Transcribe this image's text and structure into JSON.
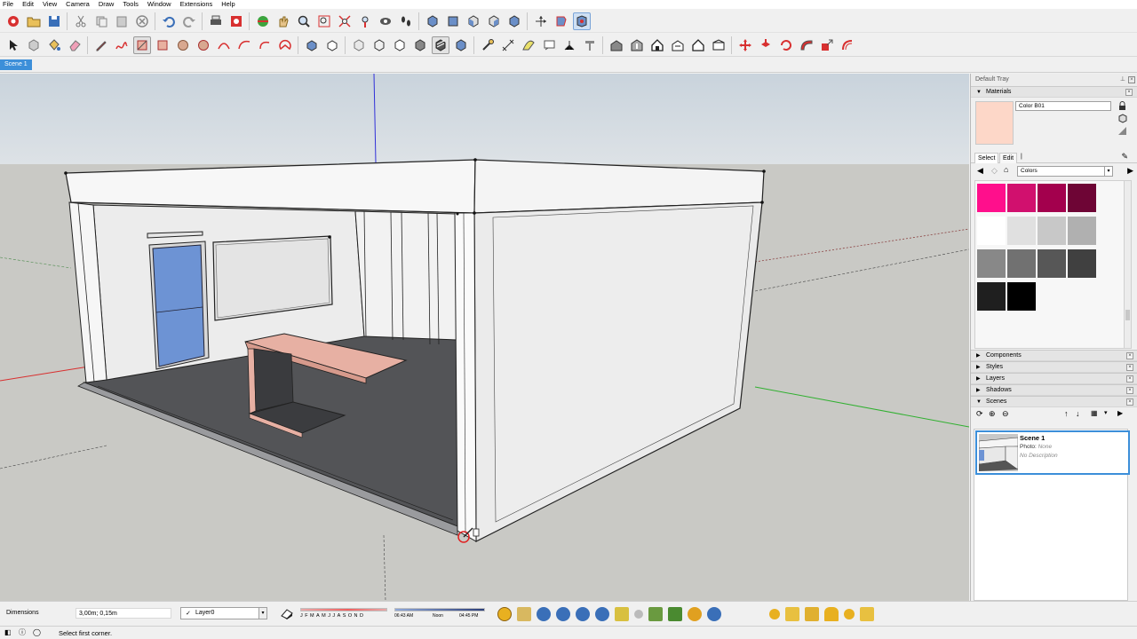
{
  "menu": [
    "File",
    "Edit",
    "View",
    "Camera",
    "Draw",
    "Tools",
    "Window",
    "Extensions",
    "Help"
  ],
  "scene_tab": "Scene 1",
  "tray": {
    "title": "Default Tray",
    "materials_header": "Materials",
    "material_name": "Color B01",
    "material_color": "#fdd7c8",
    "tab_select": "Select",
    "tab_edit": "Edit",
    "collection": "Colors",
    "swatches": [
      "#ff0f8c",
      "#d1106e",
      "#a3004d",
      "#6e0535",
      "#ffffff",
      "#e0e0e0",
      "#c8c8c8",
      "#b0b0b0",
      "#888888",
      "#717171",
      "#575757",
      "#404040",
      "#1f1f1f",
      "#000000"
    ],
    "panels": [
      "Components",
      "Styles",
      "Layers",
      "Shadows",
      "Scenes"
    ],
    "scene": {
      "name": "Scene 1",
      "photo_label": "Photo:",
      "photo_value": "None",
      "description": "No Description"
    }
  },
  "bottom": {
    "dimensions_label": "Dimensions",
    "dimensions_value": "3,00m; 0,15m",
    "layer": "Layer0",
    "months": "JFMAMJJASOND",
    "time_start": "06:43 AM",
    "time_noon": "Noon",
    "time_end": "04:45 PM"
  },
  "status": {
    "text": "Select first corner."
  }
}
